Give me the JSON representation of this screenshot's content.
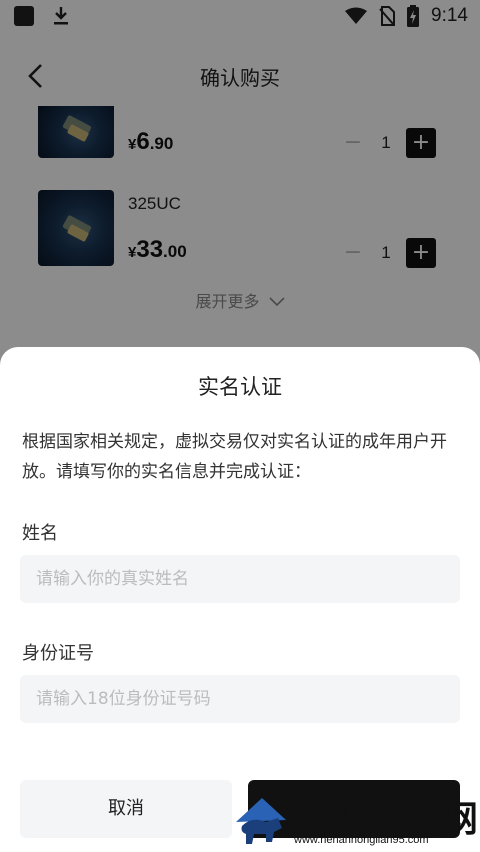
{
  "status_bar": {
    "time": "9:14",
    "icons": [
      "notification-square-icon",
      "download-icon",
      "wifi-icon",
      "no-sim-icon",
      "battery-charging-icon"
    ]
  },
  "page": {
    "title": "确认购买",
    "products": [
      {
        "name": "",
        "currency": "¥",
        "price_int": "6",
        "price_dec": ".90",
        "quantity": "1"
      },
      {
        "name": "325UC",
        "currency": "¥",
        "price_int": "33",
        "price_dec": ".00",
        "quantity": "1"
      }
    ],
    "stepper_minus": "−",
    "stepper_plus": "+",
    "expand_more": "展开更多"
  },
  "sheet": {
    "title": "实名认证",
    "description": "根据国家相关规定，虚拟交易仅对实名认证的成年用户开放。请填写你的实名信息并完成认证：",
    "name_label": "姓名",
    "name_placeholder": "请输入你的真实姓名",
    "id_label": "身份证号",
    "id_placeholder": "请输入18位身份证号码",
    "cancel_label": "取消"
  },
  "watermark": {
    "text": "鸿联手游网",
    "url": "www.henanhonglian95.com"
  }
}
